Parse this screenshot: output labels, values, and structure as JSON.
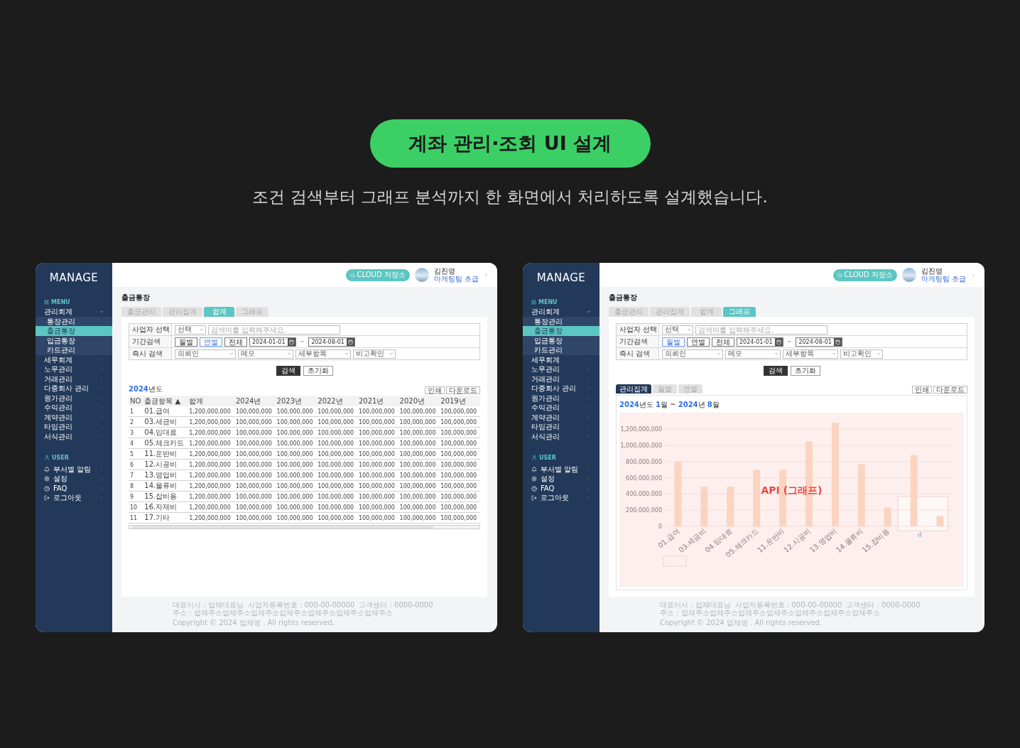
{
  "heading": {
    "title": "계좌 관리·조회 UI 설계",
    "subtitle": "조건 검색부터 그래프 분석까지 한 화면에서 처리하도록 설계했습니다."
  },
  "screens": [
    {
      "brand": "MANAGE",
      "menu_label": "MENU",
      "menu": [
        {
          "label": "관리회계",
          "expanded": true,
          "children": [
            {
              "label": "통장관리",
              "selected": false
            },
            {
              "label": "출금통장",
              "selected": true
            },
            {
              "label": "입금통장",
              "selected": false
            },
            {
              "label": "카드관리",
              "selected": false
            }
          ]
        },
        {
          "label": "세무회계",
          "expanded": false
        },
        {
          "label": "노무관리",
          "expanded": false
        },
        {
          "label": "거래관리",
          "expanded": false
        },
        {
          "label": "다중회사 관리",
          "expanded": false
        },
        {
          "label": "원가관리",
          "expanded": false
        },
        {
          "label": "수익관리",
          "expanded": false
        },
        {
          "label": "계약관리",
          "expanded": false
        },
        {
          "label": "타임관리",
          "expanded": false
        },
        {
          "label": "서식관리",
          "expanded": false
        }
      ],
      "user_label": "USER",
      "user_items": [
        {
          "label": "부서별 알림",
          "kind": "bell"
        },
        {
          "label": "설정",
          "kind": "settings"
        },
        {
          "label": "FAQ",
          "kind": "help"
        },
        {
          "label": "로그아웃",
          "kind": "logout"
        }
      ],
      "cloud_button": "CLOUD 저장소",
      "user_name": "김진영",
      "user_role": "마케팅팀 초급",
      "page_title": "출금통장",
      "tabs": [
        {
          "label": "출금관리",
          "selected": false
        },
        {
          "label": "관리집계",
          "selected": false
        },
        {
          "label": "합계",
          "selected": true
        },
        {
          "label": "그래프",
          "selected": false
        }
      ],
      "filters": [
        {
          "kind": "search",
          "label": "사업자 선택",
          "select": "선택",
          "placeholder": "검색어를 입력해주세요."
        },
        {
          "kind": "period",
          "label": "기간검색",
          "periods": [
            {
              "label": "월별",
              "selected": false
            },
            {
              "label": "연별",
              "selected": true
            },
            {
              "label": "전체",
              "selected": false
            }
          ],
          "from": "2024-01-01",
          "separator": "~",
          "to": "2024-08-01"
        },
        {
          "kind": "selects",
          "label": "즉시 검색",
          "selects": [
            "의뢰인",
            "메모",
            "세부항목",
            "비고확인"
          ]
        }
      ],
      "search_button": "검색",
      "reset_button": "초기화",
      "content": {
        "kind": "table",
        "title_parts": [
          {
            "text": "2024",
            "highlight": true
          },
          {
            "text": "년도",
            "highlight": false
          }
        ],
        "actions": [
          "인쇄",
          "다운로드"
        ],
        "columns": [
          {
            "label": "NO"
          },
          {
            "label": "출금항목",
            "mark": "▲"
          },
          {
            "label": "합계"
          },
          {
            "label": "2024년"
          },
          {
            "label": "2023년"
          },
          {
            "label": "2022년"
          },
          {
            "label": "2021년"
          },
          {
            "label": "2020년"
          },
          {
            "label": "2019년"
          }
        ],
        "rows": [
          [
            "1",
            "01.급여",
            "1,200,000,000",
            "100,000,000",
            "100,000,000",
            "100,000,000",
            "100,000,000",
            "100,000,000",
            "100,000,000"
          ],
          [
            "2",
            "03.세금비",
            "1,200,000,000",
            "100,000,000",
            "100,000,000",
            "100,000,000",
            "100,000,000",
            "100,000,000",
            "100,000,000"
          ],
          [
            "3",
            "04.임대료",
            "1,200,000,000",
            "100,000,000",
            "100,000,000",
            "100,000,000",
            "100,000,000",
            "100,000,000",
            "100,000,000"
          ],
          [
            "4",
            "05.체크카드",
            "1,200,000,000",
            "100,000,000",
            "100,000,000",
            "100,000,000",
            "100,000,000",
            "100,000,000",
            "100,000,000"
          ],
          [
            "5",
            "11.운반비",
            "1,200,000,000",
            "100,000,000",
            "100,000,000",
            "100,000,000",
            "100,000,000",
            "100,000,000",
            "100,000,000"
          ],
          [
            "6",
            "12.시공비",
            "1,200,000,000",
            "100,000,000",
            "100,000,000",
            "100,000,000",
            "100,000,000",
            "100,000,000",
            "100,000,000"
          ],
          [
            "7",
            "13.영업비",
            "1,200,000,000",
            "100,000,000",
            "100,000,000",
            "100,000,000",
            "100,000,000",
            "100,000,000",
            "100,000,000"
          ],
          [
            "8",
            "14.물류비",
            "1,200,000,000",
            "100,000,000",
            "100,000,000",
            "100,000,000",
            "100,000,000",
            "100,000,000",
            "100,000,000"
          ],
          [
            "9",
            "15.잡비용",
            "1,200,000,000",
            "100,000,000",
            "100,000,000",
            "100,000,000",
            "100,000,000",
            "100,000,000",
            "100,000,000"
          ],
          [
            "10",
            "16.자재비",
            "1,200,000,000",
            "100,000,000",
            "100,000,000",
            "100,000,000",
            "100,000,000",
            "100,000,000",
            "100,000,000"
          ],
          [
            "11",
            "17.기타",
            "1,200,000,000",
            "100,000,000",
            "100,000,000",
            "100,000,000",
            "100,000,000",
            "100,000,000",
            "100,000,000"
          ]
        ]
      },
      "footer": [
        "대표이사 : 업체대표님",
        "사업자등록번호 : 000-00-00000",
        "고객센터 : 0000-0000",
        "주소 : 업체주소업체주소업체주소업체주소업체주소업체주소업체주소"
      ],
      "copyright": "Copyright © 2024 업체명 . All rights reserved."
    },
    {
      "brand": "MANAGE",
      "menu_label": "MENU",
      "menu": [
        {
          "label": "관리회계",
          "expanded": true,
          "children": [
            {
              "label": "통장관리",
              "selected": false
            },
            {
              "label": "출금통장",
              "selected": true
            },
            {
              "label": "입금통장",
              "selected": false
            },
            {
              "label": "카드관리",
              "selected": false
            }
          ]
        },
        {
          "label": "세무회계",
          "expanded": false
        },
        {
          "label": "노무관리",
          "expanded": false
        },
        {
          "label": "거래관리",
          "expanded": false
        },
        {
          "label": "다중회사 관리",
          "expanded": false
        },
        {
          "label": "원가관리",
          "expanded": false
        },
        {
          "label": "수익관리",
          "expanded": false
        },
        {
          "label": "계약관리",
          "expanded": false
        },
        {
          "label": "타임관리",
          "expanded": false
        },
        {
          "label": "서식관리",
          "expanded": false
        }
      ],
      "user_label": "USER",
      "user_items": [
        {
          "label": "부서별 알림",
          "kind": "bell"
        },
        {
          "label": "설정",
          "kind": "settings"
        },
        {
          "label": "FAQ",
          "kind": "help"
        },
        {
          "label": "로그아웃",
          "kind": "logout"
        }
      ],
      "cloud_button": "CLOUD 저장소",
      "user_name": "김진영",
      "user_role": "마케팅팀 초급",
      "page_title": "출금통장",
      "tabs": [
        {
          "label": "출금관리",
          "selected": false
        },
        {
          "label": "관리집계",
          "selected": false
        },
        {
          "label": "합계",
          "selected": false
        },
        {
          "label": "그래프",
          "selected": true
        }
      ],
      "filters": [
        {
          "kind": "search",
          "label": "사업자 선택",
          "select": "선택",
          "placeholder": "검색어를 입력해주세요."
        },
        {
          "kind": "period",
          "label": "기간검색",
          "periods": [
            {
              "label": "월별",
              "selected": true
            },
            {
              "label": "연별",
              "selected": false
            },
            {
              "label": "전체",
              "selected": false
            }
          ],
          "from": "2024-01-01",
          "separator": "~",
          "to": "2024-08-01"
        },
        {
          "kind": "selects",
          "label": "즉시 검색",
          "selects": [
            "의뢰인",
            "메모",
            "세부항목",
            "비고확인"
          ]
        }
      ],
      "search_button": "검색",
      "reset_button": "초기화",
      "content": {
        "kind": "chart",
        "subtabs": [
          {
            "label": "관리집계",
            "selected": true
          },
          {
            "label": "월별",
            "selected": false
          },
          {
            "label": "연별",
            "selected": false
          }
        ],
        "actions": [
          "인쇄",
          "다운로드"
        ],
        "title_parts": [
          {
            "text": "2024",
            "highlight": true
          },
          {
            "text": "년도 ",
            "highlight": false
          },
          {
            "text": "1",
            "highlight": true
          },
          {
            "text": "월 ~ ",
            "highlight": false
          },
          {
            "text": "2024",
            "highlight": true
          },
          {
            "text": "년 ",
            "highlight": false
          },
          {
            "text": "8",
            "highlight": true
          },
          {
            "text": "월",
            "highlight": false
          }
        ],
        "overlay": "API (그래프)",
        "chart_data": {
          "type": "bar",
          "categories": [
            "01.급여",
            "03.세금비",
            "04.임대료",
            "05.체크카드",
            "11.운반비",
            "12.시공비",
            "13.영업비",
            "14.물류비",
            "15.잡비용",
            null,
            null
          ],
          "values": [
            800000000,
            490000000,
            490000000,
            700000000,
            700000000,
            1050000000,
            1280000000,
            770000000,
            230000000,
            880000000,
            130000000
          ],
          "ylim": [
            0,
            1300000000
          ],
          "grid": true,
          "yticks": [
            {
              "value": 0,
              "label": "0"
            },
            {
              "value": 200000000,
              "label": "200,000,000"
            },
            {
              "value": 400000000,
              "label": "400,000,000"
            },
            {
              "value": 600000000,
              "label": "600,000,000"
            },
            {
              "value": 800000000,
              "label": "800,000,000"
            },
            {
              "value": 1000000000,
              "label": "1,000,000,000"
            },
            {
              "value": 1200000000,
              "label": "1,200,000,000"
            }
          ]
        }
      },
      "footer": [
        "대표이사 : 업체대표님",
        "사업자등록번호 : 000-00-00000",
        "고객센터 : 0000-0000",
        "주소 : 업체주소업체주소업체주소업체주소업체주소업체주소업체주소"
      ],
      "copyright": "Copyright © 2024 업체명 . All rights reserved."
    }
  ]
}
